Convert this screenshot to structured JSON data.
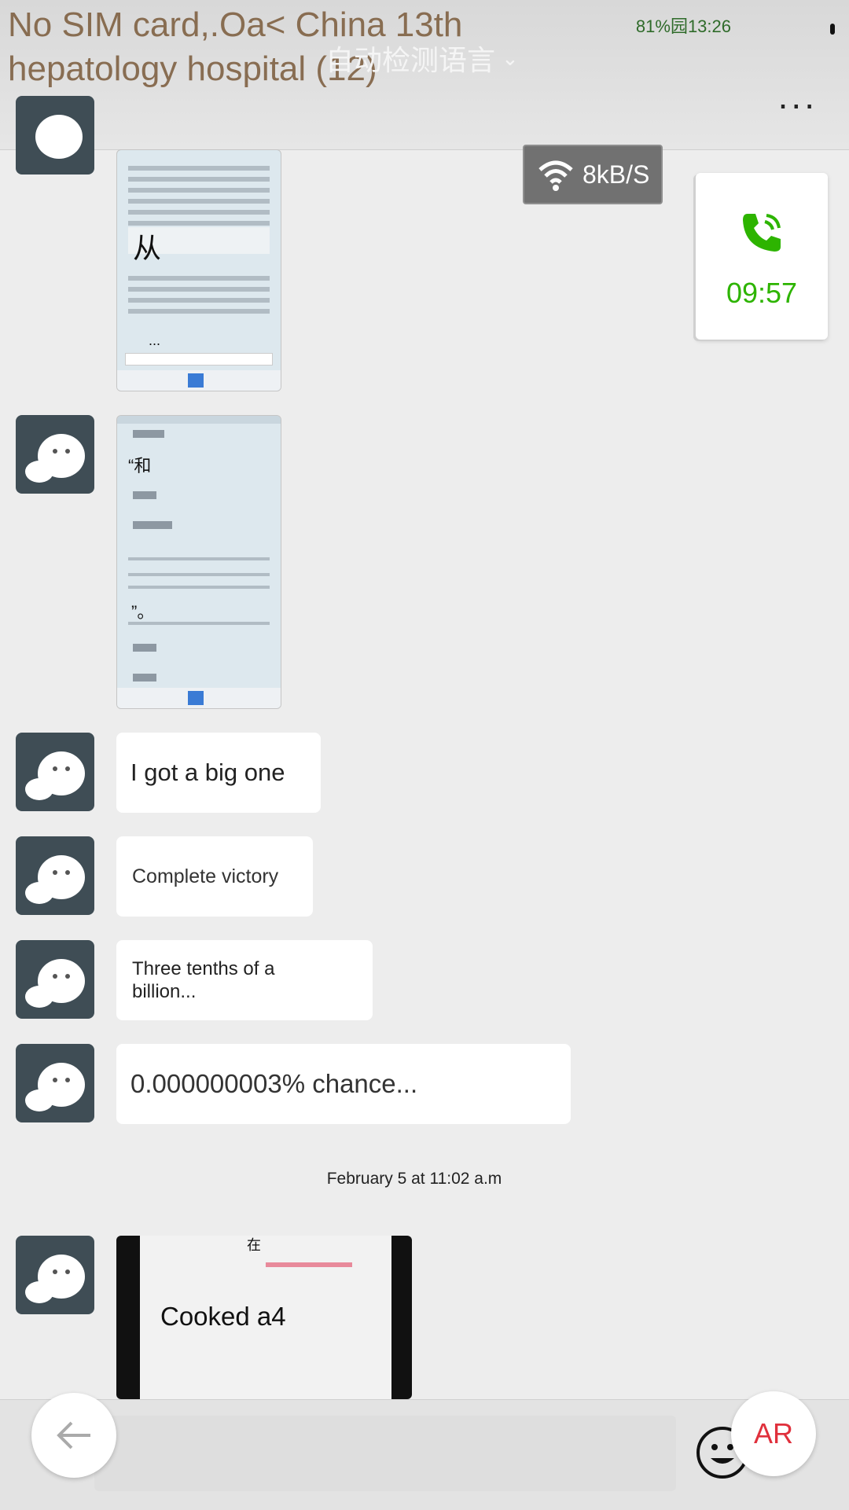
{
  "header": {
    "title": "No SIM card,.Oa< China 13th hepatology hospital (12)",
    "status": "81%园13:26",
    "language_label": "自动检测语言",
    "more": "..."
  },
  "wifi_overlay": {
    "speed": "8kB/S"
  },
  "call_card": {
    "duration": "09:57"
  },
  "messages": {
    "img1_caption": "从",
    "img1_dots": "...",
    "img2_line1": "“和",
    "img2_line2": "”。",
    "m1": "I got a big one",
    "m2": "Complete victory",
    "m3": "Three tenths of a billion...",
    "m4": "0.000000003% chance...",
    "timestamp": "February 5 at 11:02 a.m",
    "img3_top": "在",
    "img3_caption": "Cooked a4"
  },
  "bottom_bar": {
    "ar_label": "AR"
  },
  "colors": {
    "accent_green": "#2db400",
    "ar_red": "#e0303c"
  }
}
